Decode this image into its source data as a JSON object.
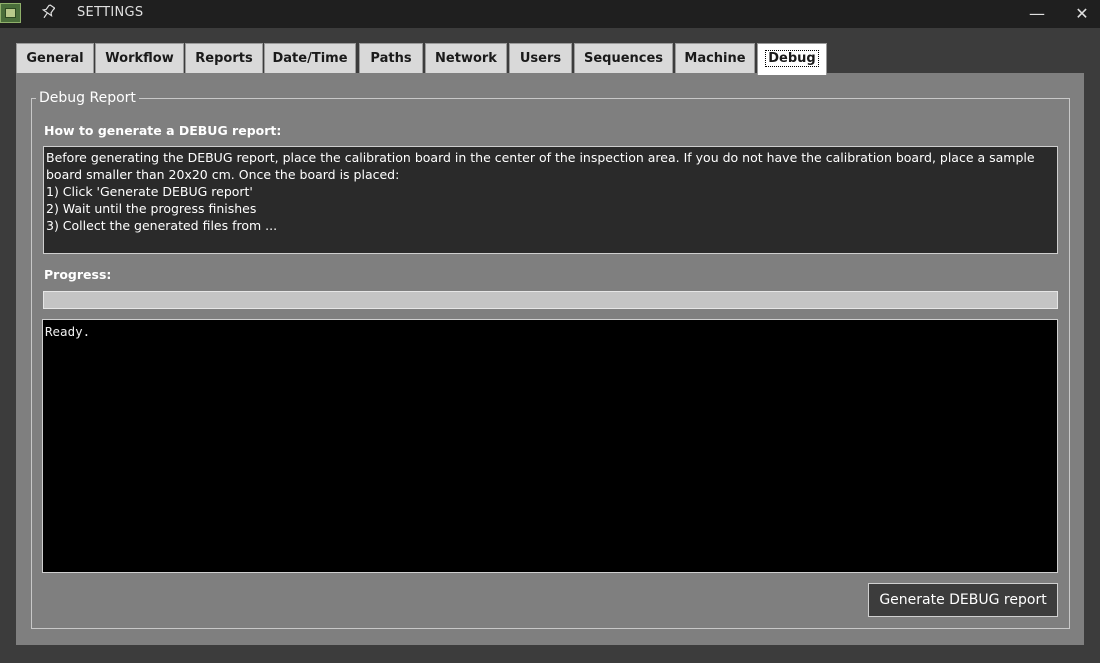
{
  "window": {
    "title": "SETTINGS",
    "app_icon": "circuit-board-icon",
    "pin_icon": "pin-icon",
    "minimize_symbol": "—",
    "close_symbol": "✕"
  },
  "tabs": [
    {
      "label": "General"
    },
    {
      "label": "Workflow"
    },
    {
      "label": "Reports"
    },
    {
      "label": "Date/Time"
    },
    {
      "label": "Paths"
    },
    {
      "label": "Network"
    },
    {
      "label": "Users"
    },
    {
      "label": "Sequences"
    },
    {
      "label": "Machine"
    },
    {
      "label": "Debug",
      "active": true
    }
  ],
  "debug": {
    "group_title": "Debug Report",
    "howto_label": "How to generate a DEBUG report:",
    "instructions": "Before generating the DEBUG report, place the calibration board in the center of the inspection area. If you do not have the calibration board, place a sample board smaller than 20x20 cm. Once the board is placed:\n1) Click 'Generate DEBUG report'\n2) Wait until the progress finishes\n3) Collect the generated files from ...",
    "progress_label": "Progress:",
    "progress_value": 0,
    "console_text": "Ready.",
    "generate_button": "Generate DEBUG report"
  },
  "colors": {
    "titlebar": "#1f1f1f",
    "panel": "#7f7f7f",
    "background": "#3c3c3c",
    "console": "#000000"
  }
}
